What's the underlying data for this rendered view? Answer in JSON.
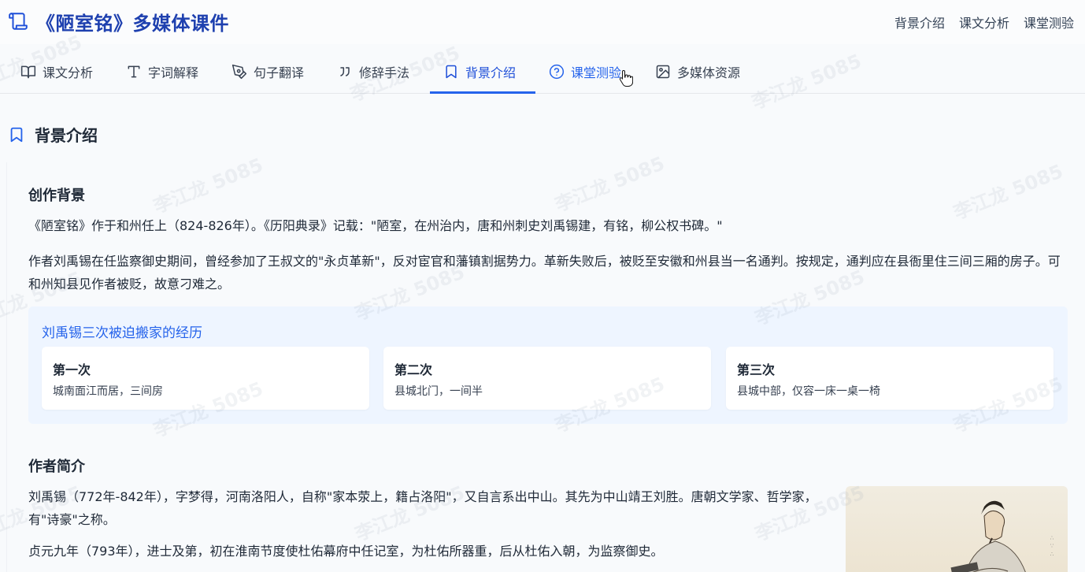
{
  "app": {
    "title": "《陋室铭》多媒体课件"
  },
  "top_nav": [
    "背景介绍",
    "课文分析",
    "课堂测验"
  ],
  "tabs": [
    {
      "label": "课文分析",
      "icon": "book-open-icon"
    },
    {
      "label": "字词解释",
      "icon": "type-icon"
    },
    {
      "label": "句子翻译",
      "icon": "pen-tool-icon"
    },
    {
      "label": "修辞手法",
      "icon": "quote-icon"
    },
    {
      "label": "背景介绍",
      "icon": "bookmark-icon",
      "active": true
    },
    {
      "label": "课堂测验",
      "icon": "help-circle-icon",
      "hover": true
    },
    {
      "label": "多媒体资源",
      "icon": "image-icon"
    }
  ],
  "section": {
    "title": "背景介绍"
  },
  "creation": {
    "heading": "创作背景",
    "p1": "《陋室铭》作于和州任上（824-826年）。《历阳典录》记载：\"陋室，在州治内，唐和州刺史刘禹锡建，有铭，柳公权书碑。\"",
    "p2": "作者刘禹锡在任监察御史期间，曾经参加了王叔文的\"永贞革新\"，反对宦官和藩镇割据势力。革新失败后，被贬至安徽和州县当一名通判。按规定，通判应在县衙里住三间三厢的房子。可和州知县见作者被贬，故意刁难之。"
  },
  "moves": {
    "title": "刘禹锡三次被迫搬家的经历",
    "items": [
      {
        "title": "第一次",
        "desc": "城南面江而居，三间房"
      },
      {
        "title": "第二次",
        "desc": "县城北门，一间半"
      },
      {
        "title": "第三次",
        "desc": "县城中部，仅容一床一桌一椅"
      }
    ]
  },
  "author": {
    "heading": "作者简介",
    "p1": "刘禹锡（772年-842年），字梦得，河南洛阳人，自称\"家本荥上，籍占洛阳\"，又自言系出中山。其先为中山靖王刘胜。唐朝文学家、哲学家，有\"诗豪\"之称。",
    "p2": "贞元九年（793年），进士及第，初在淮南节度使杜佑幕府中任记室，为杜佑所器重，后从杜佑入朝，为监察御史。"
  },
  "watermark": "李江龙 5085",
  "colors": {
    "accent": "#2563eb",
    "brand": "#1e40af",
    "callout_bg": "#eef5ff"
  }
}
